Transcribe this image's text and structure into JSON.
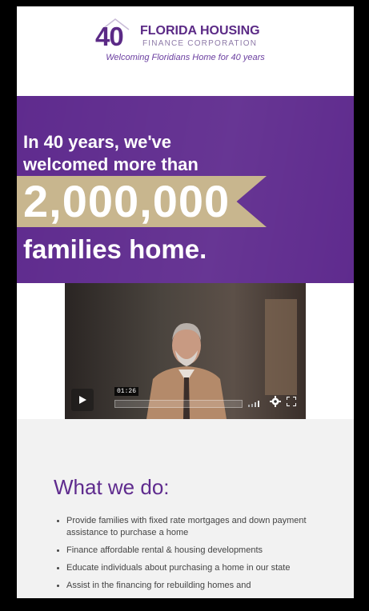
{
  "header": {
    "logo_number": "40",
    "logo_name": "FLORIDA HOUSING",
    "logo_sub": "FINANCE CORPORATION",
    "tagline": "Welcoming Floridians Home for 40 years"
  },
  "hero": {
    "line1a": "In 40 years, we've",
    "line1b": "welcomed more than",
    "number": "2,000,000",
    "line3": "families home."
  },
  "video": {
    "timestamp": "01:26",
    "progress": 0.0
  },
  "section": {
    "title": "What we do:",
    "items": [
      "Provide families with fixed rate mortgages and down payment assistance to purchase a home",
      "Finance affordable rental & housing developments",
      "Educate individuals about purchasing a home in our state",
      "Assist in the financing for rebuilding homes and"
    ]
  },
  "colors": {
    "brand_purple": "#5f2b8e",
    "banner_gold": "#c8b68e"
  }
}
